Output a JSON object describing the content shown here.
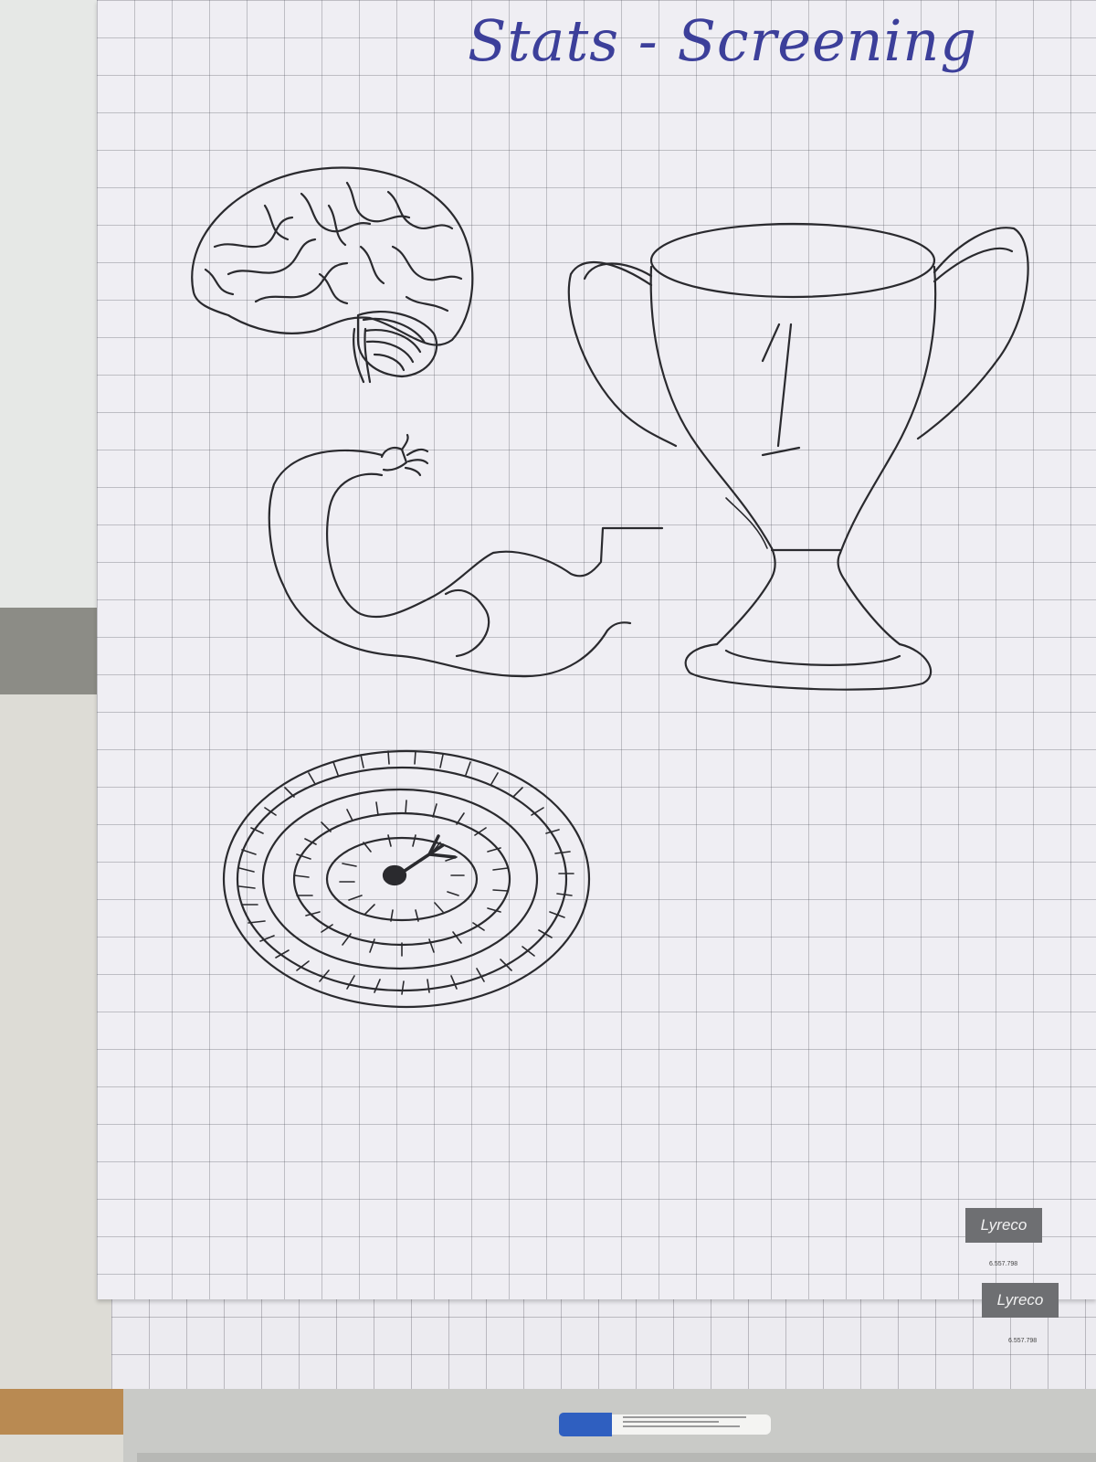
{
  "title": "Stats - Screening",
  "trophy_number": "1",
  "brand_primary": "Lyreco",
  "brand_primary_code": "6.557.798",
  "brand_secondary": "Lyreco",
  "brand_secondary_code": "6.557.798",
  "ink_color": "#2a2a2e",
  "title_color": "#3c3f9a",
  "drawings": [
    "brain-drawing",
    "flexed-arm-drawing",
    "dartboard-drawing",
    "trophy-drawing"
  ]
}
